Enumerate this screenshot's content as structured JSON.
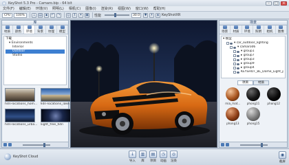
{
  "window": {
    "title": "KeyShot 5.3 Pro - Camaro.bip - 64 bit",
    "buttons": {
      "minimize": "–",
      "maximize": "□",
      "close": "×"
    }
  },
  "menubar": {
    "items": [
      "文件(F)",
      "编辑(E)",
      "环境(V)",
      "照明(L)",
      "相机(C)",
      "图像(I)",
      "渲染(R)",
      "视图(W)",
      "窗口(W)",
      "帮助(H)"
    ]
  },
  "toolbar": {
    "workspace": "CPU",
    "cores_label": "100%",
    "cpu_label": "CPU 使用量",
    "zoom_label": "性能",
    "zoom_value": "30.0",
    "tool_label": "KeyShotXR",
    "icons": [
      "import-icon",
      "open-icon",
      "save-icon",
      "undo-icon",
      "redo-icon",
      "screenshot-icon",
      "pause-icon",
      "pin-icon",
      "lock-icon"
    ]
  },
  "left_panel": {
    "title": "库",
    "tabs": [
      {
        "label": "材质",
        "icon": "material-icon"
      },
      {
        "label": "颜色",
        "icon": "color-icon"
      },
      {
        "label": "环境",
        "icon": "environment-icon"
      },
      {
        "label": "背景",
        "icon": "background-icon"
      },
      {
        "label": "纹理",
        "icon": "texture-icon"
      },
      {
        "label": "模型",
        "icon": "model-icon"
      }
    ],
    "active_tab": "环境",
    "tree_root": "下载",
    "tree": [
      {
        "label": "▾ Environments",
        "indent": 1,
        "selected": false
      },
      {
        "label": "Interior",
        "indent": 2,
        "selected": false
      },
      {
        "label": "Outdoor",
        "indent": 2,
        "selected": true
      },
      {
        "label": "Studio",
        "indent": 2,
        "selected": false
      }
    ],
    "thumbnails": [
      {
        "caption": "hdri-locations_hom...",
        "style": "interior"
      },
      {
        "caption": "hdri-locations_lake...",
        "style": "lake"
      },
      {
        "caption": "hdri-locations_urba...",
        "style": "urban"
      },
      {
        "caption": "night_free_hdri",
        "style": "night"
      }
    ]
  },
  "right_panel": {
    "title": "场景",
    "tabs": [
      {
        "label": "场景",
        "icon": "scene-icon"
      },
      {
        "label": "材质",
        "icon": "material-icon"
      },
      {
        "label": "环境",
        "icon": "environment-icon"
      },
      {
        "label": "照明",
        "icon": "lighting-icon"
      },
      {
        "label": "相机",
        "icon": "camera-icon"
      },
      {
        "label": "图像",
        "icon": "image-icon"
      }
    ],
    "tree": [
      {
        "label": "▾ 模型",
        "indent": 0
      },
      {
        "label": "▾ car_outdoor_lighting",
        "indent": 1
      },
      {
        "label": "▾ camaro06",
        "indent": 2
      },
      {
        "label": "▾ group1",
        "indent": 3
      },
      {
        "label": "▸ group7",
        "indent": 3
      },
      {
        "label": "▸ group3",
        "indent": 3
      },
      {
        "label": "▸ group9",
        "indent": 3
      },
      {
        "label": "▸ group4",
        "indent": 3
      },
      {
        "label": "KEYSHOT_BL_Dome_Light_p...",
        "indent": 3
      }
    ],
    "subtabs": [
      "项目",
      "材质"
    ],
    "active_subtab": "项目",
    "materials": [
      {
        "caption": "mia_mat...",
        "style": "copper"
      },
      {
        "caption": "phong11",
        "style": "black"
      },
      {
        "caption": "phong12",
        "style": "darkblack"
      },
      {
        "caption": "phong13",
        "style": "copper2"
      },
      {
        "caption": "phong15",
        "style": "gray"
      }
    ]
  },
  "bottom_bar": {
    "brand": "KeyShot Cloud",
    "tools": [
      {
        "label": "导入",
        "icon": "import-icon"
      },
      {
        "label": "库",
        "icon": "library-icon"
      },
      {
        "label": "项目",
        "icon": "project-icon"
      },
      {
        "label": "动画",
        "icon": "animation-icon"
      },
      {
        "label": "渲染",
        "icon": "render-icon"
      }
    ],
    "right_tool": {
      "label": "截屏",
      "icon": "screenshot-icon"
    }
  },
  "colors": {
    "accent": "#3d7fd1",
    "car_body": "#e07a1f",
    "sky": "#1c2a4a"
  }
}
